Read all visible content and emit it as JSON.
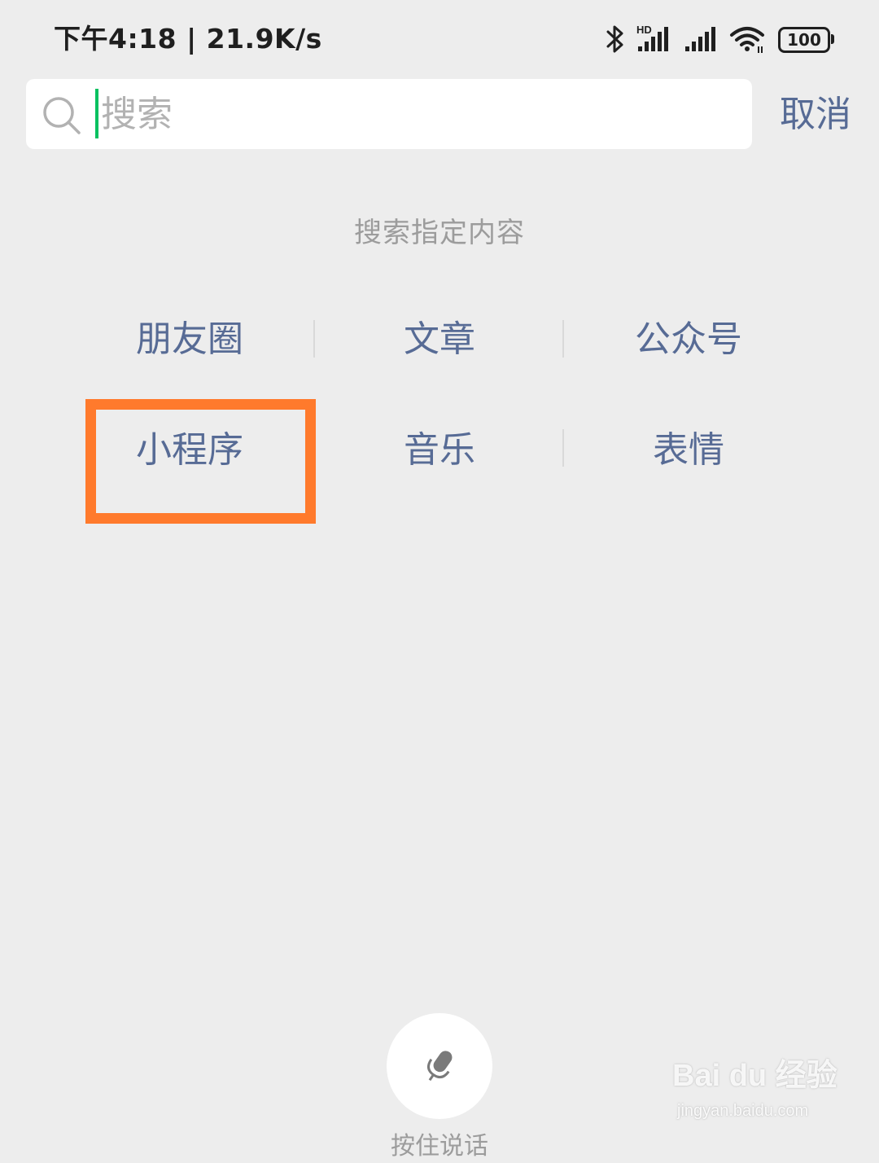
{
  "status_bar": {
    "time": "下午4:18 | 21.9K/s",
    "network_badge": "HD",
    "battery": "100",
    "icons": [
      "bluetooth-icon",
      "signal-hd-icon",
      "signal-icon",
      "wifi-icon",
      "battery-icon"
    ]
  },
  "search": {
    "placeholder": "搜索",
    "value": "",
    "cancel_label": "取消",
    "caret_color": "#07c160"
  },
  "section_title": "搜索指定内容",
  "options": [
    {
      "label": "朋友圈"
    },
    {
      "label": "文章"
    },
    {
      "label": "公众号"
    },
    {
      "label": "小程序"
    },
    {
      "label": "音乐"
    },
    {
      "label": "表情"
    }
  ],
  "highlight": {
    "target": "小程序",
    "color": "#ff7a2c"
  },
  "voice": {
    "label": "按住说话",
    "icon": "microphone-icon"
  },
  "watermark": {
    "logo": "Bai du 经验",
    "url": "jingyan.baidu.com"
  },
  "colors": {
    "background": "#ededed",
    "link": "#576b95",
    "muted": "#9c9c9c"
  }
}
